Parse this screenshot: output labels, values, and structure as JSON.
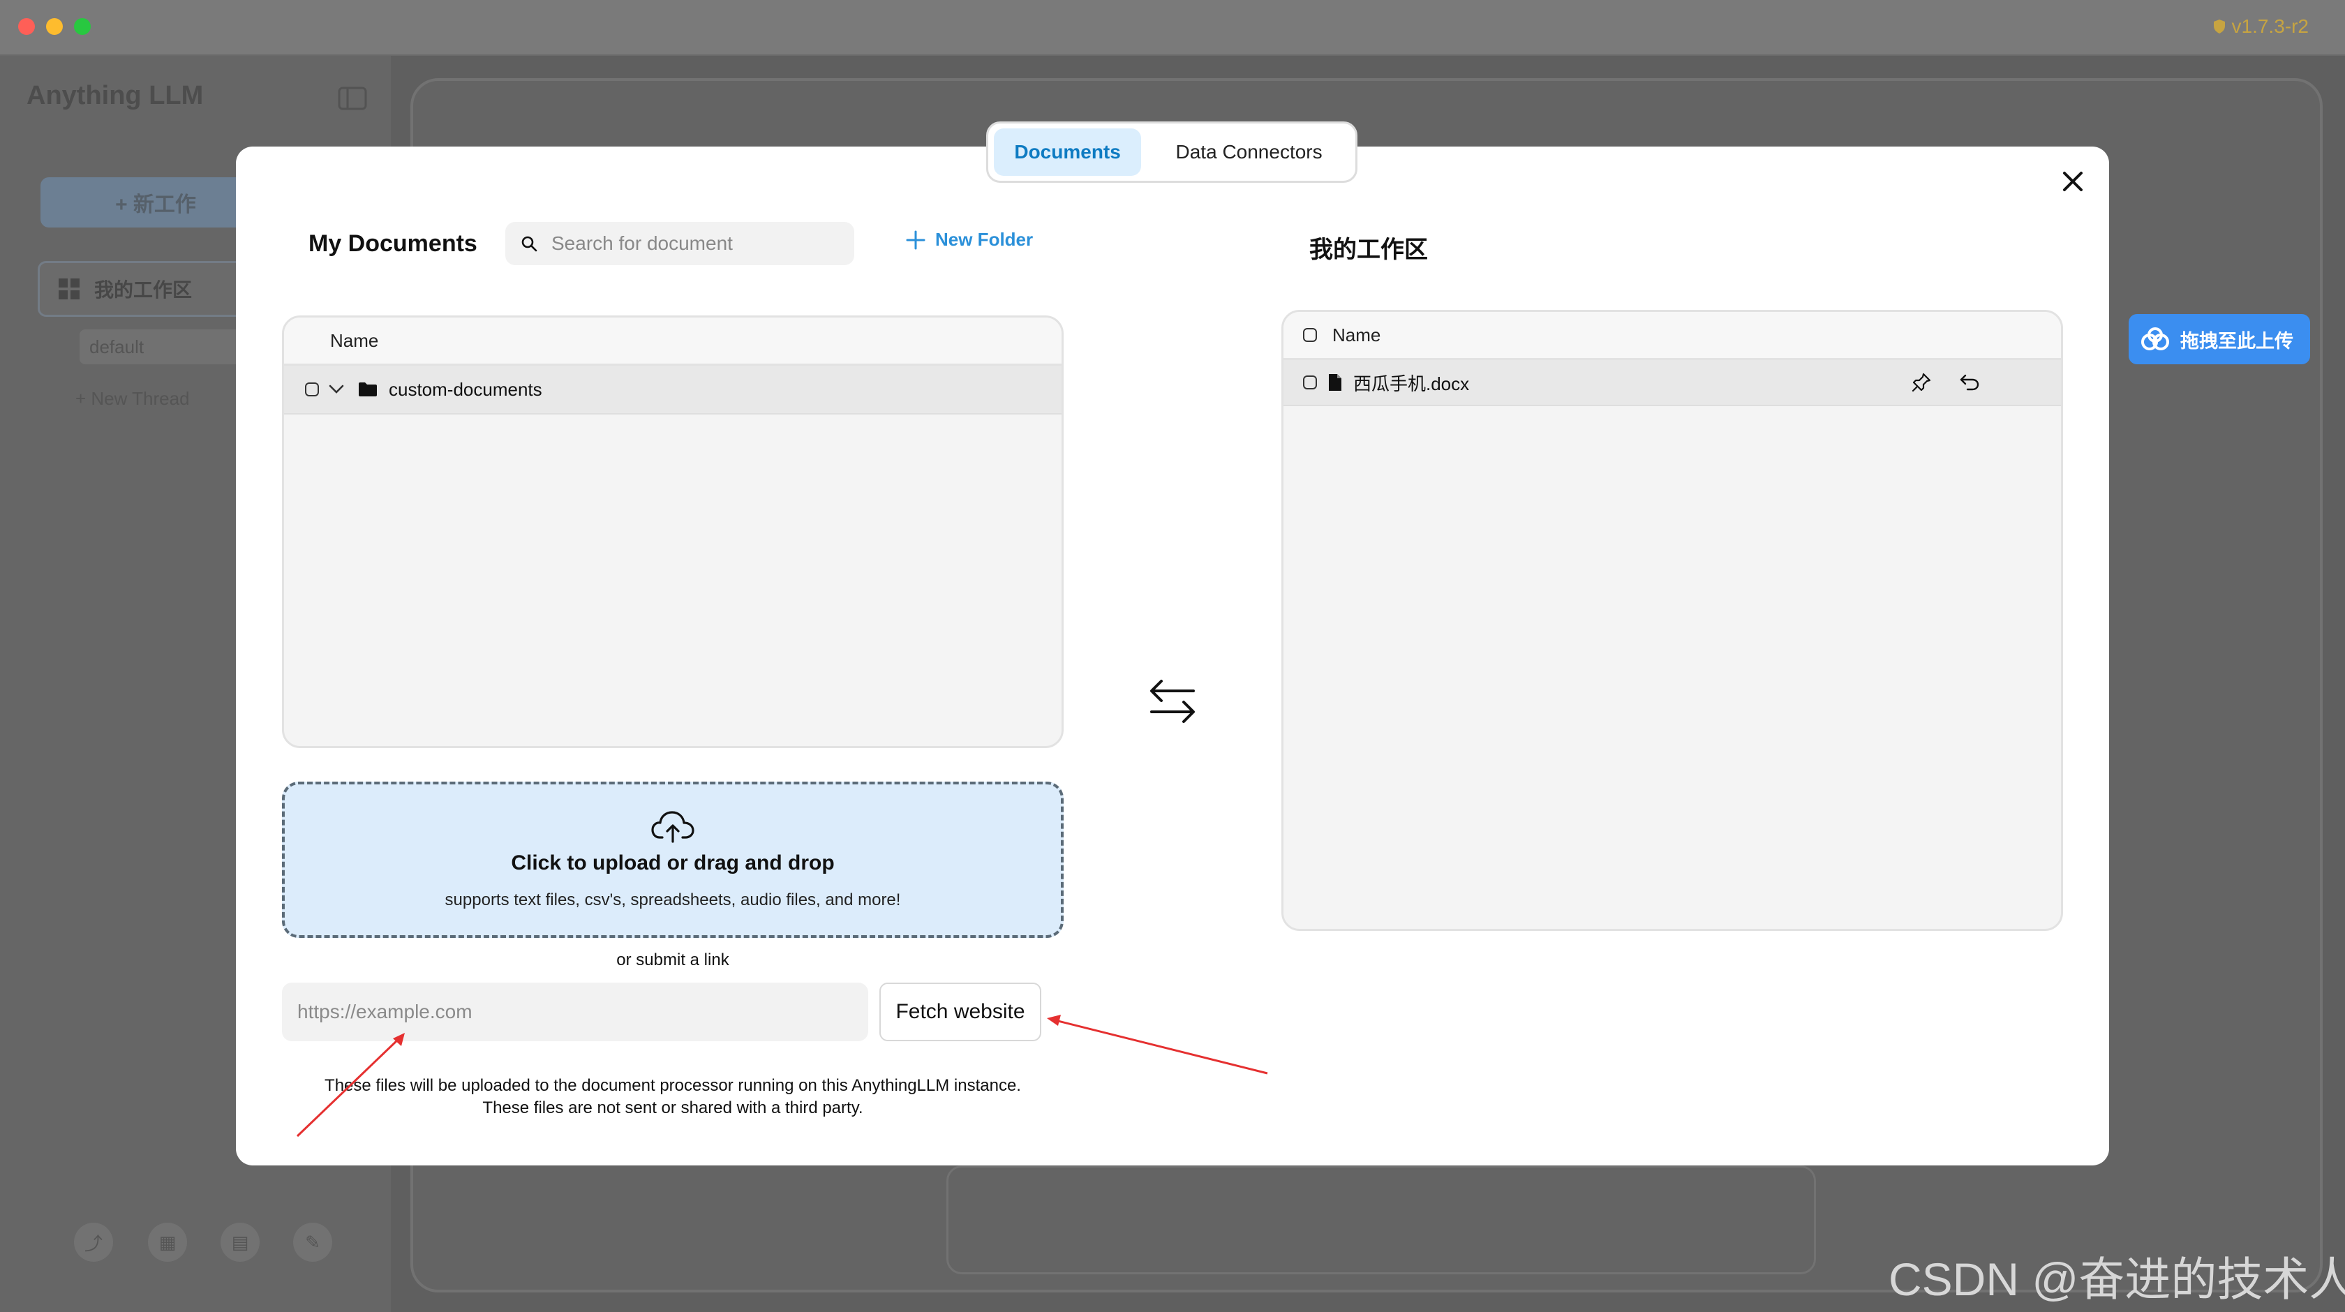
{
  "window": {
    "version": "v1.7.3-r2"
  },
  "background_app": {
    "logo": "Anything LLM",
    "new_workspace_button": "+ 新工作",
    "workspace": "我的工作区",
    "thread": "default",
    "new_thread": "+ New Thread"
  },
  "modal": {
    "tabs": [
      "Documents",
      "Data Connectors"
    ],
    "active_tab": "Documents",
    "my_documents": {
      "title": "My Documents",
      "search_placeholder": "Search for document",
      "new_folder": "New Folder",
      "column_name": "Name",
      "rows": [
        "custom-documents"
      ]
    },
    "workspace": {
      "title": "我的工作区",
      "column_name": "Name",
      "rows": [
        "西瓜手机.docx"
      ]
    },
    "upload": {
      "title": "Click to upload or drag and drop",
      "subtitle": "supports text files, csv's, spreadsheets, audio files, and more!"
    },
    "link": {
      "label": "or submit a link",
      "placeholder": "https://example.com",
      "fetch_button": "Fetch website"
    },
    "disclaimer": {
      "line1": "These files will be uploaded to the document processor running on this AnythingLLM instance.",
      "line2": "These files are not sent or shared with a third party."
    }
  },
  "overlay": {
    "upload_button": "拖拽至此上传",
    "watermark": "CSDN @奋进的技术人"
  },
  "colors": {
    "accent": "#2b90d9",
    "tab_active_bg": "#dbeefd",
    "annotation_arrow": "#e53030"
  }
}
